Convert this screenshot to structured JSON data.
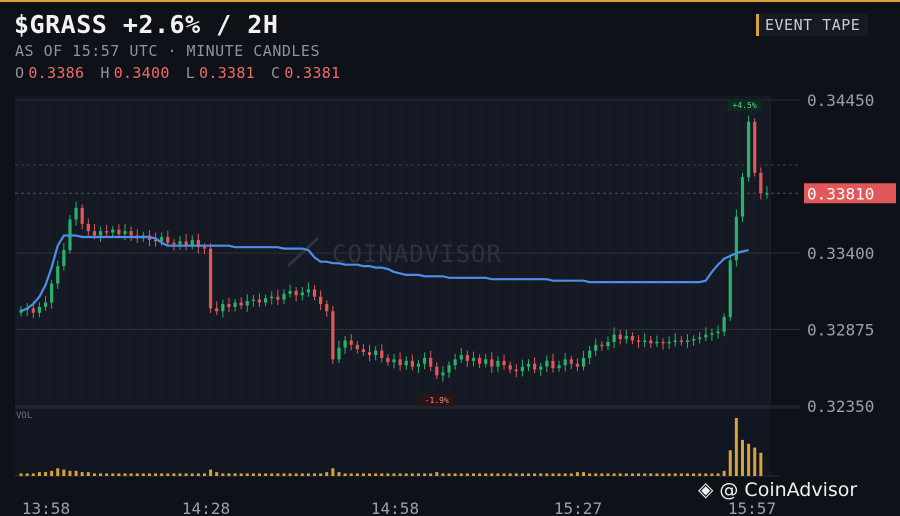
{
  "header": {
    "title": "$GRASS +2.6% / 2H",
    "subtitle": "AS OF 15:57 UTC · MINUTE CANDLES",
    "ohlc": [
      {
        "key": "O",
        "value": "0.3386"
      },
      {
        "key": "H",
        "value": "0.3400"
      },
      {
        "key": "L",
        "value": "0.3381"
      },
      {
        "key": "C",
        "value": "0.3381"
      }
    ]
  },
  "tape_button": {
    "label": "EVENT TAPE"
  },
  "brand": {
    "text": "@ CoinAdvisor",
    "icon": "diamond-logo-icon"
  },
  "watermark": "COINADVISOR",
  "colors": {
    "up": "#26b36a",
    "down": "#e0585a",
    "vwap": "#4d8fe8",
    "volume": "#d9a23a",
    "price_tag_bg": "#e0585a",
    "accent": "#d9a23a"
  },
  "chart_data": {
    "type": "candlestick",
    "ylim": [
      0.3235,
      0.3445
    ],
    "yticks": [
      "0.34450",
      "0.33400",
      "0.32875",
      "0.32350"
    ],
    "xticks": [
      "13:58",
      "14:28",
      "14:58",
      "15:27",
      "15:57"
    ],
    "last_price": 0.3381,
    "last_price_label": "0.33810",
    "volume_label": "VOL",
    "annotations": [
      {
        "text": "+4.5%",
        "at": "high",
        "time": "15:54"
      },
      {
        "text": "-1.9%",
        "at": "low",
        "time": "14:45"
      }
    ],
    "close": [
      0.3301,
      0.3302,
      0.3299,
      0.3303,
      0.3306,
      0.3319,
      0.3331,
      0.3342,
      0.3363,
      0.3371,
      0.336,
      0.3355,
      0.3352,
      0.3355,
      0.3354,
      0.3356,
      0.3353,
      0.3355,
      0.3352,
      0.335,
      0.3352,
      0.3349,
      0.3348,
      0.3351,
      0.3347,
      0.3346,
      0.3348,
      0.3345,
      0.3349,
      0.3344,
      0.3343,
      0.3302,
      0.33,
      0.3305,
      0.3303,
      0.3306,
      0.3304,
      0.3307,
      0.3308,
      0.3306,
      0.3309,
      0.331,
      0.3308,
      0.3312,
      0.3314,
      0.3311,
      0.3313,
      0.3315,
      0.331,
      0.3305,
      0.33,
      0.3267,
      0.3275,
      0.328,
      0.3277,
      0.3274,
      0.3272,
      0.327,
      0.3273,
      0.3268,
      0.3265,
      0.3267,
      0.3263,
      0.3266,
      0.3262,
      0.3264,
      0.3268,
      0.3262,
      0.3256,
      0.3258,
      0.3263,
      0.3267,
      0.327,
      0.3266,
      0.3268,
      0.3264,
      0.3267,
      0.3262,
      0.3266,
      0.3263,
      0.326,
      0.3259,
      0.3262,
      0.3264,
      0.326,
      0.3262,
      0.3266,
      0.3261,
      0.3263,
      0.3267,
      0.3264,
      0.3262,
      0.3268,
      0.3273,
      0.3277,
      0.3276,
      0.3279,
      0.3284,
      0.3281,
      0.3283,
      0.328,
      0.3279,
      0.328,
      0.3278,
      0.3279,
      0.3278,
      0.3279,
      0.328,
      0.3279,
      0.328,
      0.3281,
      0.3282,
      0.3284,
      0.3285,
      0.3286,
      0.3296,
      0.3335,
      0.3365,
      0.3392,
      0.343,
      0.3395,
      0.3381,
      0.3381
    ],
    "vwap": [
      0.33,
      0.3302,
      0.3305,
      0.331,
      0.3318,
      0.333,
      0.3345,
      0.3352,
      0.3352,
      0.3352,
      0.3351,
      0.3351,
      0.3351,
      0.3351,
      0.3351,
      0.3351,
      0.3351,
      0.3351,
      0.3351,
      0.3351,
      0.3351,
      0.3351,
      0.335,
      0.3347,
      0.3345,
      0.3345,
      0.3345,
      0.3345,
      0.3345,
      0.3345,
      0.3345,
      0.3345,
      0.3345,
      0.3345,
      0.3345,
      0.3344,
      0.3344,
      0.3344,
      0.3344,
      0.3344,
      0.3344,
      0.3344,
      0.3344,
      0.3343,
      0.3343,
      0.3343,
      0.3343,
      0.3342,
      0.3337,
      0.3334,
      0.3334,
      0.3333,
      0.3333,
      0.3332,
      0.3332,
      0.3332,
      0.3331,
      0.3331,
      0.333,
      0.333,
      0.3329,
      0.3327,
      0.3326,
      0.3325,
      0.3325,
      0.3325,
      0.3324,
      0.3324,
      0.3324,
      0.3324,
      0.3323,
      0.3323,
      0.3323,
      0.3323,
      0.3323,
      0.3323,
      0.3323,
      0.3322,
      0.3322,
      0.3322,
      0.3322,
      0.3322,
      0.3322,
      0.3322,
      0.3322,
      0.3322,
      0.3322,
      0.3321,
      0.3321,
      0.3321,
      0.3321,
      0.3321,
      0.3321,
      0.332,
      0.332,
      0.332,
      0.332,
      0.332,
      0.332,
      0.332,
      0.332,
      0.332,
      0.332,
      0.332,
      0.332,
      0.332,
      0.332,
      0.332,
      0.332,
      0.332,
      0.332,
      0.332,
      0.3321,
      0.3327,
      0.3332,
      0.3336,
      0.3338,
      0.334,
      0.3341,
      0.3342
    ],
    "volume": [
      2,
      2,
      2,
      3,
      3,
      4,
      6,
      5,
      4,
      4,
      3,
      3,
      2,
      2,
      2,
      2,
      2,
      2,
      2,
      2,
      2,
      2,
      2,
      2,
      2,
      2,
      2,
      2,
      2,
      2,
      2,
      5,
      3,
      2,
      2,
      2,
      2,
      2,
      2,
      2,
      2,
      2,
      2,
      2,
      2,
      2,
      2,
      2,
      2,
      2,
      3,
      6,
      3,
      2,
      2,
      2,
      2,
      2,
      2,
      2,
      2,
      2,
      2,
      2,
      2,
      2,
      2,
      2,
      3,
      2,
      2,
      2,
      2,
      2,
      2,
      2,
      2,
      2,
      2,
      2,
      2,
      2,
      2,
      2,
      2,
      2,
      2,
      2,
      2,
      2,
      2,
      3,
      3,
      2,
      2,
      2,
      2,
      2,
      2,
      2,
      2,
      2,
      2,
      2,
      2,
      2,
      2,
      2,
      2,
      2,
      2,
      2,
      2,
      2,
      2,
      4,
      20,
      45,
      28,
      25,
      22,
      18
    ]
  }
}
